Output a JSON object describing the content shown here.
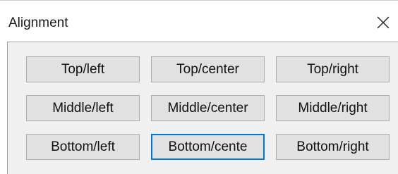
{
  "window": {
    "title": "Alignment",
    "close_icon": "close-icon"
  },
  "buttons": [
    {
      "label": "Top/left"
    },
    {
      "label": "Top/center"
    },
    {
      "label": "Top/right"
    },
    {
      "label": "Middle/left"
    },
    {
      "label": "Middle/center"
    },
    {
      "label": "Middle/right"
    },
    {
      "label": "Bottom/left"
    },
    {
      "label": "Bottom/cente"
    },
    {
      "label": "Bottom/right"
    }
  ],
  "colors": {
    "focus_border": "#0078d7",
    "button_face": "#e1e1e1",
    "client_background": "#f0f0f0"
  }
}
